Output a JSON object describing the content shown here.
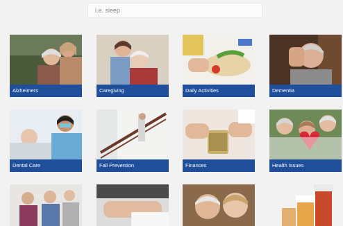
{
  "search": {
    "placeholder": "i.e. sleep"
  },
  "tiles": [
    {
      "label": "Alzheimers",
      "icon": "elderly-couple-photo"
    },
    {
      "label": "Caregiving",
      "icon": "caregiver-hug-photo"
    },
    {
      "label": "Daily Activities",
      "icon": "cooking-photo"
    },
    {
      "label": "Dementia",
      "icon": "worried-man-photo"
    },
    {
      "label": "Dental Care",
      "icon": "dentist-photo"
    },
    {
      "label": "Fall Prevention",
      "icon": "stair-rail-photo"
    },
    {
      "label": "Finances",
      "icon": "coin-jar-photo"
    },
    {
      "label": "Health Issues",
      "icon": "heart-women-photo"
    },
    {
      "label": "",
      "icon": "group-photo"
    },
    {
      "label": "",
      "icon": "handshake-photo"
    },
    {
      "label": "",
      "icon": "smiling-couple-photo"
    },
    {
      "label": "",
      "icon": "medicine-bottles-photo"
    }
  ],
  "colors": {
    "caption_bg": "#1f4f9a",
    "page_bg": "#f2f2f2"
  }
}
